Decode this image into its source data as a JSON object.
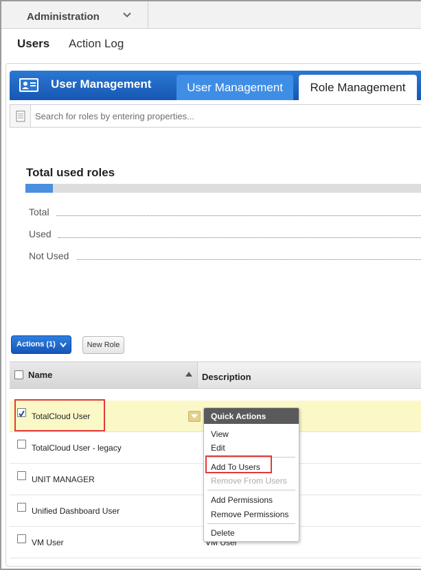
{
  "module_selector": {
    "label": "Administration"
  },
  "subnav": {
    "users": "Users",
    "action_log": "Action Log"
  },
  "header": {
    "title": "User Management",
    "tabs": [
      {
        "label": "User Management",
        "active": false
      },
      {
        "label": "Role Management",
        "active": true
      }
    ]
  },
  "search": {
    "placeholder": "Search for roles by entering properties..."
  },
  "stats": {
    "title": "Total used roles",
    "used_fraction": 0.07,
    "rows": [
      {
        "label": "Total"
      },
      {
        "label": "Used"
      },
      {
        "label": "Not Used"
      }
    ]
  },
  "toolbar": {
    "actions_label": "Actions (1)",
    "new_role_label": "New Role"
  },
  "table": {
    "columns": {
      "name": "Name",
      "description": "Description"
    },
    "rows": [
      {
        "name": "TotalCloud User",
        "description": "",
        "checked": true
      },
      {
        "name": "TotalCloud User - legacy",
        "description": "",
        "checked": false
      },
      {
        "name": "UNIT MANAGER",
        "description": "",
        "checked": false
      },
      {
        "name": "Unified Dashboard User",
        "description": "",
        "checked": false
      },
      {
        "name": "VM User",
        "description": "VM User",
        "checked": false
      }
    ]
  },
  "quick_actions": {
    "title": "Quick Actions",
    "items": {
      "view": "View",
      "edit": "Edit",
      "add_to_users": "Add To Users",
      "remove_from_users": "Remove From Users",
      "add_permissions": "Add Permissions",
      "remove_permissions": "Remove Permissions",
      "delete": "Delete"
    }
  },
  "colors": {
    "accent_blue": "#1f6bc6",
    "selected_row": "#fbf8c8",
    "highlight_red": "#e0393a"
  }
}
